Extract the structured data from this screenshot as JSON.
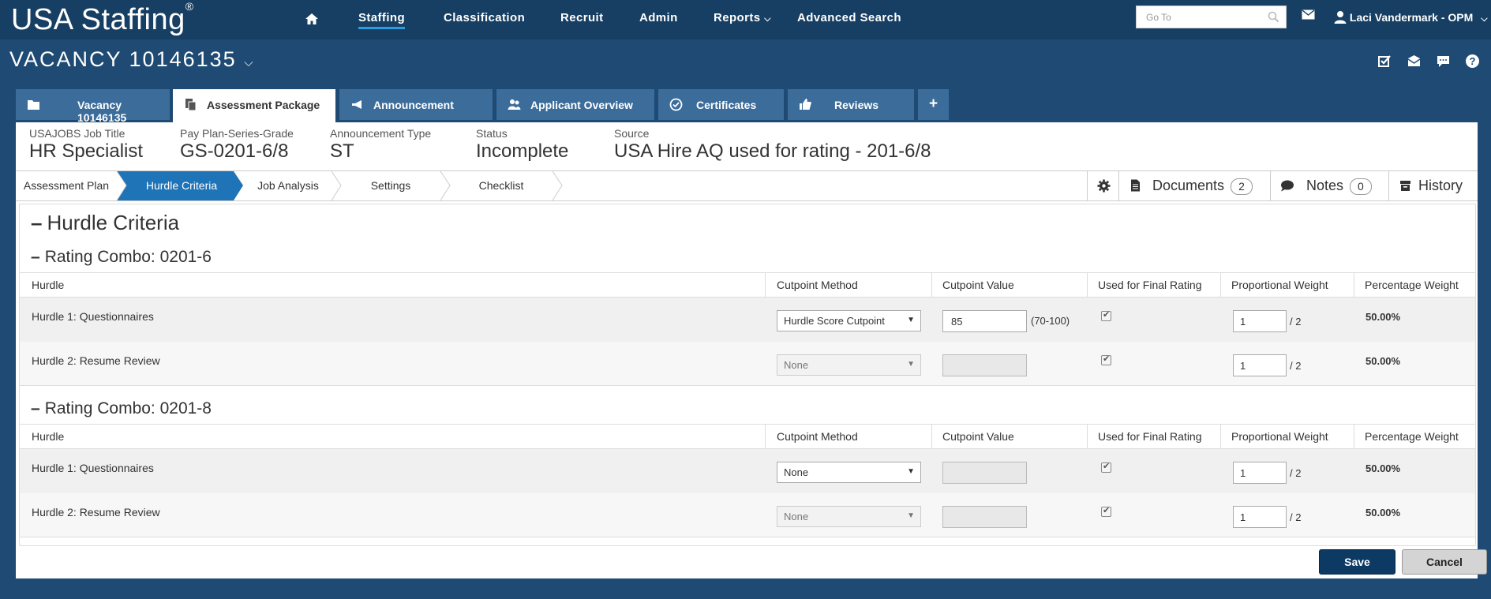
{
  "brand": {
    "name": "USA Staffing",
    "mark": "®"
  },
  "nav": {
    "items": [
      {
        "label": "Staffing",
        "active": true
      },
      {
        "label": "Classification"
      },
      {
        "label": "Recruit"
      },
      {
        "label": "Admin"
      },
      {
        "label": "Reports"
      },
      {
        "label": "Advanced Search"
      }
    ],
    "goto_placeholder": "Go To",
    "user": "Laci Vandermark - OPM"
  },
  "vacancy": {
    "title": "VACANCY 10146135"
  },
  "tabs": [
    {
      "label": "Vacancy 10146135"
    },
    {
      "label": "Assessment Package",
      "active": true
    },
    {
      "label": "Announcement"
    },
    {
      "label": "Applicant Overview"
    },
    {
      "label": "Certificates"
    },
    {
      "label": "Reviews"
    },
    {
      "label": "+"
    }
  ],
  "summary": [
    {
      "label": "USAJOBS Job Title",
      "value": "HR Specialist"
    },
    {
      "label": "Pay Plan-Series-Grade",
      "value": "GS-0201-6/8"
    },
    {
      "label": "Announcement Type",
      "value": "ST"
    },
    {
      "label": "Status",
      "value": "Incomplete"
    },
    {
      "label": "Source",
      "value": "USA Hire AQ used for rating - 201-6/8"
    }
  ],
  "steps": [
    "Assessment Plan",
    "Hurdle Criteria",
    "Job Analysis",
    "Settings",
    "Checklist"
  ],
  "tools": {
    "documents_label": "Documents",
    "documents_count": "2",
    "notes_label": "Notes",
    "notes_count": "0",
    "history_label": "History"
  },
  "section_title": "Hurdle Criteria",
  "columns": [
    "Hurdle",
    "Cutpoint Method",
    "Cutpoint Value",
    "Used for Final Rating",
    "Proportional Weight",
    "Percentage Weight"
  ],
  "combos": [
    {
      "title": "Rating Combo: 0201-6",
      "rows": [
        {
          "hurdle": "Hurdle 1: Questionnaires",
          "method": "Hurdle Score Cutpoint",
          "value": "85",
          "range": "(70-100)",
          "weight": "1",
          "of": "/ 2",
          "pct": "50.00%"
        },
        {
          "hurdle": "Hurdle 2: Resume Review",
          "method": "None",
          "value": "",
          "range": "",
          "weight": "1",
          "of": "/ 2",
          "pct": "50.00%"
        }
      ]
    },
    {
      "title": "Rating Combo: 0201-8",
      "rows": [
        {
          "hurdle": "Hurdle 1: Questionnaires",
          "method": "None",
          "value": "",
          "range": "",
          "weight": "1",
          "of": "/ 2",
          "pct": "50.00%"
        },
        {
          "hurdle": "Hurdle 2: Resume Review",
          "method": "None",
          "value": "",
          "range": "",
          "weight": "1",
          "of": "/ 2",
          "pct": "50.00%"
        }
      ]
    }
  ],
  "buttons": {
    "save": "Save",
    "cancel": "Cancel"
  }
}
